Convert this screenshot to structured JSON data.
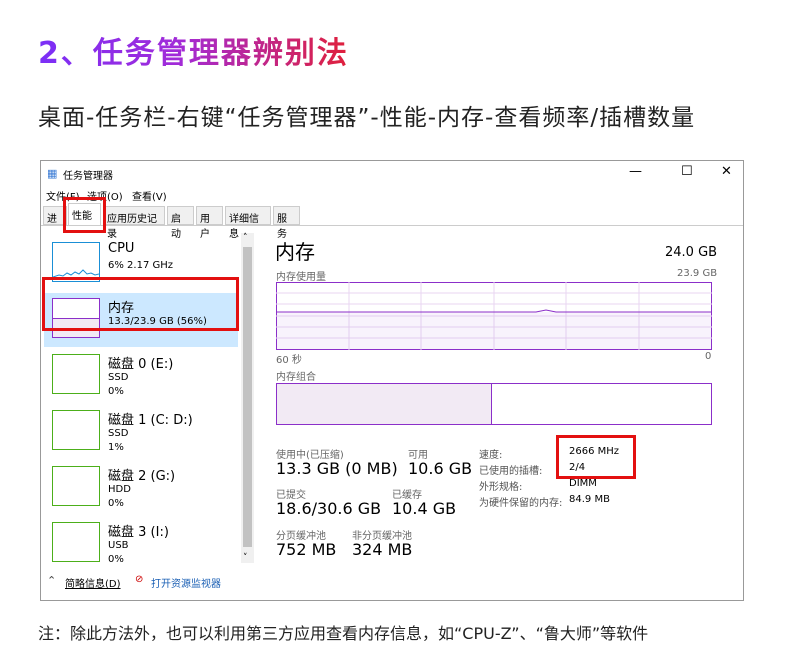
{
  "heading": "2、任务管理器辨别法",
  "subheading": "桌面-任务栏-右键“任务管理器”-性能-内存-查看频率/插槽数量",
  "window": {
    "title": "任务管理器",
    "menu": [
      "文件(F)",
      "选项(O)",
      "查看(V)"
    ],
    "tabs": [
      "进程",
      "性能",
      "应用历史记录",
      "启动",
      "用户",
      "详细信息",
      "服务"
    ],
    "sidebar": [
      {
        "name": "CPU",
        "line1": "6% 2.17 GHz",
        "color": "#1a8fd6"
      },
      {
        "name": "内存",
        "line1": "13.3/23.9 GB (56%)",
        "color": "#8b2fc9"
      },
      {
        "name": "磁盘 0 (E:)",
        "line1": "SSD",
        "line2": "0%",
        "color": "#4caf1a"
      },
      {
        "name": "磁盘 1 (C: D:)",
        "line1": "SSD",
        "line2": "1%",
        "color": "#4caf1a"
      },
      {
        "name": "磁盘 2 (G:)",
        "line1": "HDD",
        "line2": "0%",
        "color": "#4caf1a"
      },
      {
        "name": "磁盘 3 (I:)",
        "line1": "USB",
        "line2": "0%",
        "color": "#4caf1a"
      }
    ],
    "main": {
      "title": "内存",
      "total": "24.0 GB",
      "usage_label": "内存使用量",
      "usage_max": "23.9 GB",
      "time_left": "60 秒",
      "time_right": "0",
      "composition_label": "内存组合",
      "in_use_fraction": 0.56,
      "stats": [
        {
          "label": "使用中(已压缩)",
          "value": "13.3 GB (0 MB)"
        },
        {
          "label": "可用",
          "value": "10.6 GB"
        },
        {
          "label": "已提交",
          "value": "18.6/30.6 GB"
        },
        {
          "label": "已缓存",
          "value": "10.4 GB"
        },
        {
          "label": "分页缓冲池",
          "value": "752 MB"
        },
        {
          "label": "非分页缓冲池",
          "value": "324 MB"
        }
      ],
      "props": [
        {
          "key": "速度:",
          "value": "2666 MHz"
        },
        {
          "key": "已使用的插槽:",
          "value": "2/4"
        },
        {
          "key": "外形规格:",
          "value": "DIMM"
        },
        {
          "key": "为硬件保留的内存:",
          "value": "84.9 MB"
        }
      ]
    },
    "footer": {
      "summary": "简略信息(D)",
      "monitor": "打开资源监视器"
    }
  },
  "note": "注：除此方法外，也可以利用第三方应用查看内存信息，如“CPU-Z”、“鲁大师”等软件",
  "highlight_color": "#e31010"
}
